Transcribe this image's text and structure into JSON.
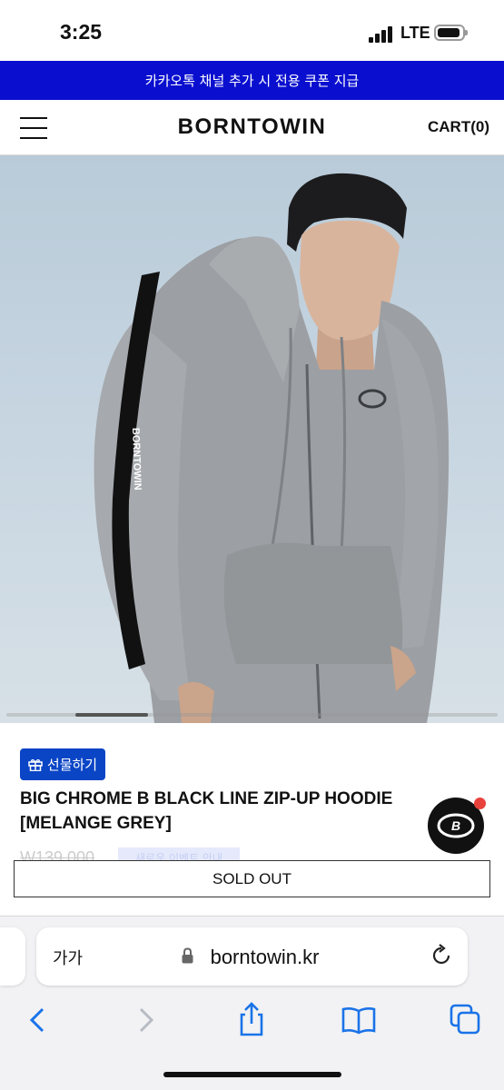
{
  "status_bar": {
    "time": "3:25",
    "network": "LTE"
  },
  "promo": {
    "text": "카카오톡 채널 추가 시 전용 쿠폰 지급"
  },
  "header": {
    "logo": "BORNTOWIN",
    "cart_label": "CART(0)"
  },
  "product": {
    "image_logo_text": "BORNTOWIN",
    "gift_label": "선물하기",
    "title": "BIG CHROME B BLACK LINE ZIP-UP HOODIE [MELANGE GREY]",
    "price": "W139,000",
    "badge": "새로운 이벤트 안내",
    "sold_out_label": "SOLD OUT"
  },
  "browser": {
    "text_size_label": "가가",
    "url": "borntowin.kr"
  },
  "colors": {
    "promo_bg": "#0a0fcf",
    "gift_bg": "#0a45c6",
    "safari_blue": "#1a73e8",
    "notify_dot": "#e8423c"
  },
  "icons": [
    "menu-icon",
    "gift-icon",
    "lock-icon",
    "reload-icon",
    "back-icon",
    "forward-icon",
    "share-icon",
    "bookmarks-icon",
    "tabs-icon",
    "brand-badge-icon"
  ]
}
